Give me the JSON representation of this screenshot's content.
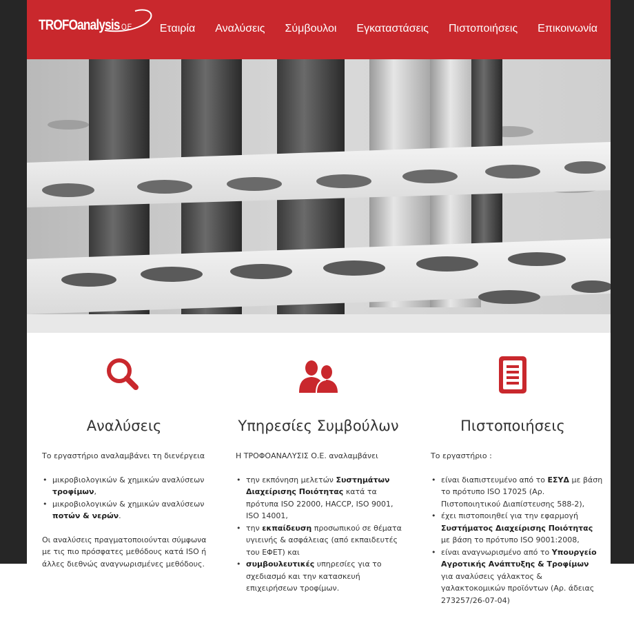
{
  "brand": {
    "name": "TROFOanalysis",
    "suffix": "Ο.Ε."
  },
  "nav": [
    {
      "label": "Εταιρία"
    },
    {
      "label": "Αναλύσεις"
    },
    {
      "label": "Σύμβουλοι"
    },
    {
      "label": "Εγκαταστάσεις"
    },
    {
      "label": "Πιστοποιήσεις"
    },
    {
      "label": "Επικοινωνία"
    }
  ],
  "colors": {
    "brand_red": "#c9282d",
    "background": "#262626"
  },
  "hero": {
    "image": "laboratory test tubes in a rack (grayscale)"
  },
  "columns": [
    {
      "icon": "search-icon",
      "title": "Αναλύσεις",
      "intro": "Το εργαστήριο αναλαμβάνει τη διενέργεια",
      "items": [
        {
          "text": "μικροβιολογικών & χημικών αναλύσεων ",
          "bold": "τροφίμων",
          "tail": ","
        },
        {
          "text": "μικροβιολογικών & χημικών αναλύσεων ",
          "bold": "ποτών & νερών",
          "tail": "."
        }
      ],
      "outro": "Οι αναλύσεις πραγματοποιούνται σύμφωνα με τις πιο πρόσφατες μεθόδους κατά ISO ή άλλες διεθνώς αναγνωρισμένες μεθόδους."
    },
    {
      "icon": "users-icon",
      "title": "Υπηρεσίες Συμβούλων",
      "intro": "Η ΤΡΟΦΟΑΝΑΛΥΣΙΣ Ο.Ε. αναλαμβάνει",
      "items": [
        {
          "pre": "την εκπόνηση μελετών ",
          "bold": "Συστημάτων Διαχείρισης Ποιότητας",
          "tail": " κατά τα πρότυπα ISO 22000, HACCP, ISO 9001, ISO 14001,"
        },
        {
          "pre": "την ",
          "bold": "εκπαίδευση",
          "tail": " προσωπικού σε θέματα υγιεινής & ασφάλειας (από εκπαιδευτές του ΕΦΕΤ) και"
        },
        {
          "pre": "",
          "bold": "συμβουλευτικές",
          "tail": " υπηρεσίες για το σχεδιασμό και την κατασκευή επιχειρήσεων τροφίμων."
        }
      ]
    },
    {
      "icon": "document-icon",
      "title": "Πιστοποιήσεις",
      "intro": "Το εργαστήριο :",
      "items": [
        {
          "pre": "είναι διαπιστευμένο από το ",
          "bold": "ΕΣΥΔ",
          "tail": " με βάση το πρότυπο ISO 17025 (Αρ. Πιστοποιητικού Διαπίστευσης 588-2),"
        },
        {
          "pre": "έχει πιστοποιηθεί για την εφαρμογή ",
          "bold": "Συστήματος Διαχείρισης Ποιότητας",
          "tail": " με βάση το πρότυπο ISO 9001:2008,"
        },
        {
          "pre": "είναι αναγνωρισμένο από το ",
          "bold": "Υπουργείο Αγροτικής Ανάπτυξης & Τροφίμων",
          "tail": " για αναλύσεις γάλακτος & γαλακτοκομικών προϊόντων (Αρ. άδειας 273257/26-07-04)"
        }
      ]
    }
  ]
}
